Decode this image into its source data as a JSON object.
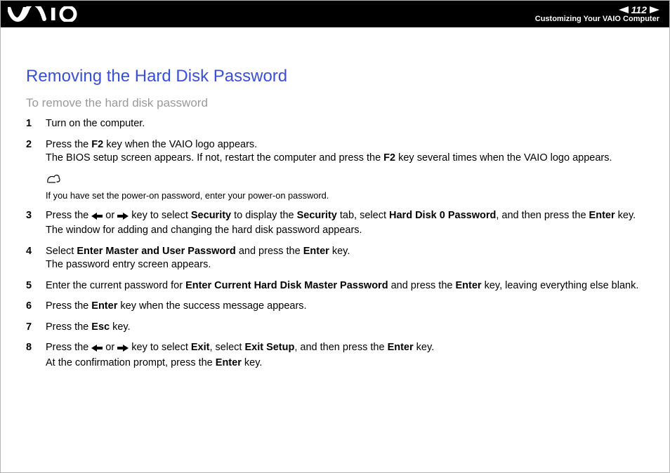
{
  "header": {
    "page_number": "112",
    "section": "Customizing Your VAIO Computer"
  },
  "title": "Removing the Hard Disk Password",
  "subtitle": "To remove the hard disk password",
  "steps": [
    {
      "num": "1",
      "segments": [
        {
          "t": "Turn on the computer."
        }
      ]
    },
    {
      "num": "2",
      "segments": [
        {
          "t": "Press the "
        },
        {
          "t": "F2",
          "b": true
        },
        {
          "t": " key when the VAIO logo appears."
        },
        {
          "br": true
        },
        {
          "t": "The BIOS setup screen appears. If not, restart the computer and press the "
        },
        {
          "t": "F2",
          "b": true
        },
        {
          "t": " key several times when the VAIO logo appears."
        }
      ],
      "note": "If you have set the power-on password, enter your power-on password."
    },
    {
      "num": "3",
      "segments": [
        {
          "t": "Press the "
        },
        {
          "arrow": "left"
        },
        {
          "t": " or "
        },
        {
          "arrow": "right"
        },
        {
          "t": " key to select "
        },
        {
          "t": "Security",
          "b": true
        },
        {
          "t": " to display the "
        },
        {
          "t": "Security",
          "b": true
        },
        {
          "t": " tab, select "
        },
        {
          "t": "Hard Disk 0 Password",
          "b": true
        },
        {
          "t": ", and then press the "
        },
        {
          "t": "Enter",
          "b": true
        },
        {
          "t": " key."
        },
        {
          "br": true
        },
        {
          "t": "The window for adding and changing the hard disk password appears."
        }
      ]
    },
    {
      "num": "4",
      "segments": [
        {
          "t": "Select "
        },
        {
          "t": "Enter Master and User Password",
          "b": true
        },
        {
          "t": " and press the "
        },
        {
          "t": "Enter",
          "b": true
        },
        {
          "t": " key."
        },
        {
          "br": true
        },
        {
          "t": "The password entry screen appears."
        }
      ]
    },
    {
      "num": "5",
      "segments": [
        {
          "t": "Enter the current password for "
        },
        {
          "t": "Enter Current Hard Disk Master Password",
          "b": true
        },
        {
          "t": " and press the "
        },
        {
          "t": "Enter",
          "b": true
        },
        {
          "t": " key, leaving everything else blank."
        }
      ]
    },
    {
      "num": "6",
      "segments": [
        {
          "t": "Press the "
        },
        {
          "t": "Enter",
          "b": true
        },
        {
          "t": " key when the success message appears."
        }
      ]
    },
    {
      "num": "7",
      "segments": [
        {
          "t": "Press the "
        },
        {
          "t": "Esc",
          "b": true
        },
        {
          "t": " key."
        }
      ]
    },
    {
      "num": "8",
      "segments": [
        {
          "t": "Press the "
        },
        {
          "arrow": "left"
        },
        {
          "t": " or "
        },
        {
          "arrow": "right"
        },
        {
          "t": " key to select "
        },
        {
          "t": "Exit",
          "b": true
        },
        {
          "t": ", select "
        },
        {
          "t": "Exit Setup",
          "b": true
        },
        {
          "t": ", and then press the "
        },
        {
          "t": "Enter",
          "b": true
        },
        {
          "t": " key."
        },
        {
          "br": true
        },
        {
          "t": "At the confirmation prompt, press the "
        },
        {
          "t": "Enter",
          "b": true
        },
        {
          "t": " key."
        }
      ]
    }
  ]
}
